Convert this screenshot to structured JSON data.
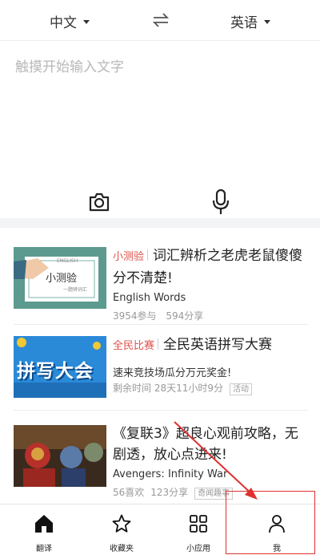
{
  "language_bar": {
    "source_language": "中文",
    "target_language": "英语"
  },
  "input": {
    "placeholder": "触摸开始输入文字"
  },
  "feed": [
    {
      "tag": "小测验",
      "title": "词汇辨析之老虎老鼠傻傻分不清楚!",
      "subtitle": "English Words",
      "stats": [
        "3954参与",
        "594分享"
      ],
      "thumb_text": "小测验",
      "thumb_small": "ENGLISH",
      "thumb_caption": "一题辨词汇"
    },
    {
      "tag": "全民比赛",
      "title": "全民英语拼写大赛",
      "subtitle": "速来竞技场瓜分万元奖金!",
      "stats": [
        "剩余时间 28天11小时9分"
      ],
      "badge": "活动",
      "thumb_text": "拼写大会"
    },
    {
      "tag": "",
      "title": "《复联3》超良心观前攻略，无剧透，放心点进来!",
      "subtitle": "Avengers: Infinity War",
      "stats": [
        "56喜欢",
        "123分享"
      ],
      "badge": "奇闻趣事"
    }
  ],
  "tabbar": {
    "items": [
      {
        "label": "翻译",
        "icon": "home-icon"
      },
      {
        "label": "收藏夹",
        "icon": "star-icon"
      },
      {
        "label": "小应用",
        "icon": "grid-icon"
      },
      {
        "label": "我",
        "icon": "person-icon"
      }
    ]
  },
  "colors": {
    "accent_red": "#e0504a",
    "annotation_red": "#e03030"
  }
}
